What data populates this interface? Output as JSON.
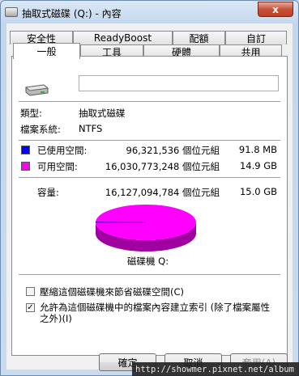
{
  "window": {
    "title": "抽取式磁碟 (Q:) - 內容",
    "close_label": "x"
  },
  "tabs": {
    "row_top": [
      "安全性",
      "ReadyBoost",
      "配額",
      "自訂"
    ],
    "row_bottom": [
      "一般",
      "工具",
      "硬體",
      "共用"
    ]
  },
  "general": {
    "drive_name_value": "",
    "type_label": "類型:",
    "type_value": "抽取式磁碟",
    "fs_label": "檔案系統:",
    "fs_value": "NTFS",
    "used_label": "已使用空間:",
    "used_bytes": "96,321,536 個位元組",
    "used_size": "91.8 MB",
    "free_label": "可用空間:",
    "free_bytes": "16,030,773,248 個位元組",
    "free_size": "14.9 GB",
    "capacity_label": "容量:",
    "capacity_bytes": "16,127,094,784 個位元組",
    "capacity_size": "15.0 GB",
    "disk_label": "磁碟機 Q:",
    "compress_label": "壓縮這個磁碟機來節省磁碟空間(C)",
    "compress_checked": false,
    "index_label_line1": "允許為這個磁碟機中的檔案內容建立索引 (除了檔案屬性",
    "index_label_line2": "之外)(I)",
    "index_checked": true
  },
  "colors": {
    "used": "#0000ff",
    "free": "#ff00ff",
    "free_dark": "#a000a0"
  },
  "chart_data": {
    "type": "pie",
    "values": [
      96321536,
      16030773248
    ],
    "labels": [
      "已使用空間",
      "可用空間"
    ]
  },
  "buttons": {
    "ok": "確定",
    "cancel": "取消",
    "apply": "套用(A)"
  },
  "watermark": "http://showmer.pixnet.net/album"
}
